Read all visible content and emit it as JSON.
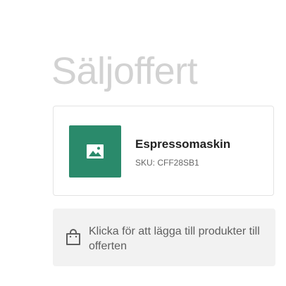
{
  "page": {
    "title": "Säljoffert"
  },
  "product": {
    "name": "Espressomaskin",
    "sku": "SKU: CFF28SB1",
    "thumbnail_icon": "image-placeholder-icon",
    "thumbnail_color": "#2a8a6b"
  },
  "add_products": {
    "icon": "shopping-bag-icon",
    "label": "Klicka för att lägga till produkter till offerten"
  }
}
